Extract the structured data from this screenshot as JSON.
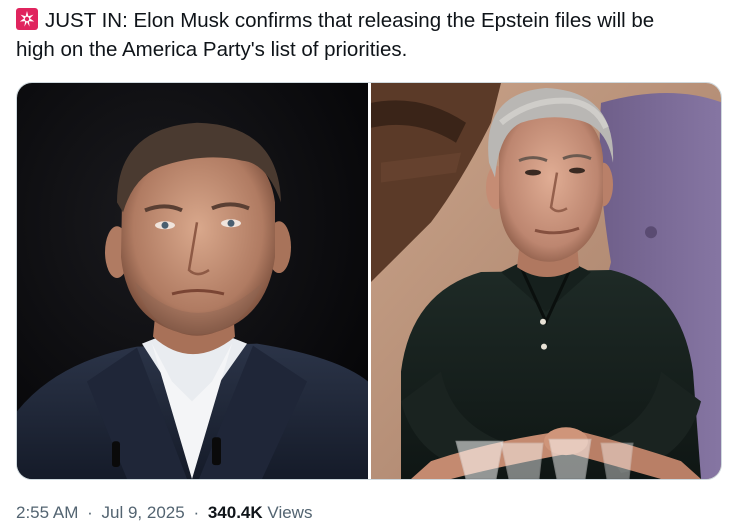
{
  "tweet": {
    "text_line1": "JUST IN: Elon Musk confirms that releasing the Epstein files will be",
    "text_line2": "high on the America Party's list of priorities.",
    "emoji_icon": "rotating-light-siren-icon"
  },
  "media": {
    "left_photo": "elon-musk-portrait",
    "right_photo": "jeffrey-epstein-portrait"
  },
  "meta": {
    "time": "2:55 AM",
    "date": "Jul 9, 2025",
    "views_count": "340.4K",
    "views_label": "Views",
    "separator": "·"
  },
  "colors": {
    "text": "#0f1419",
    "secondary": "#536471",
    "siren": "#e0245e",
    "border": "#cfd9de"
  }
}
